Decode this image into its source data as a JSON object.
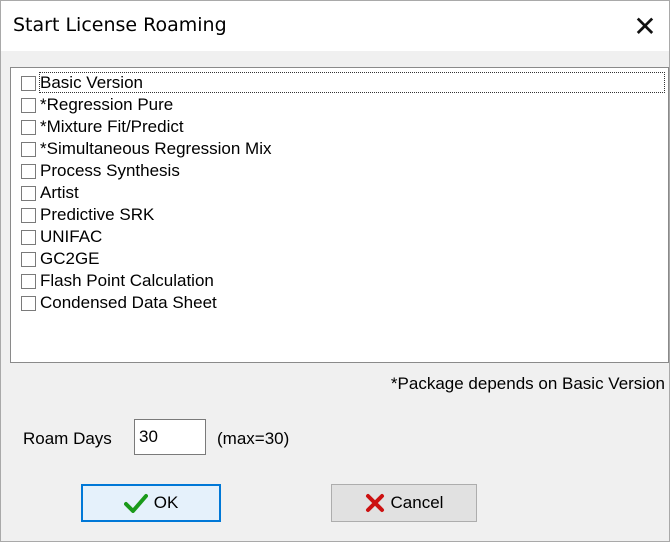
{
  "window": {
    "title": "Start License Roaming",
    "close_glyph": "✕"
  },
  "packages": [
    {
      "label": "Basic Version",
      "checked": false,
      "focused": true
    },
    {
      "label": "*Regression Pure",
      "checked": false
    },
    {
      "label": "*Mixture Fit/Predict",
      "checked": false
    },
    {
      "label": "*Simultaneous Regression Mix",
      "checked": false
    },
    {
      "label": "Process Synthesis",
      "checked": false
    },
    {
      "label": "Artist",
      "checked": false
    },
    {
      "label": "Predictive SRK",
      "checked": false
    },
    {
      "label": "UNIFAC",
      "checked": false
    },
    {
      "label": "GC2GE",
      "checked": false
    },
    {
      "label": "Flash Point Calculation",
      "checked": false
    },
    {
      "label": "Condensed Data Sheet",
      "checked": false
    }
  ],
  "note": "*Package depends on Basic Version",
  "roam": {
    "label": "Roam Days",
    "value": "30",
    "max_text": "(max=30)"
  },
  "buttons": {
    "ok_label": "OK",
    "cancel_label": "Cancel"
  },
  "icons": {
    "ok": "checkmark-icon",
    "cancel": "x-mark-icon"
  },
  "colors": {
    "ok_check": "#1a9a1a",
    "cancel_x": "#cc1111",
    "focus_border": "#0078d7"
  }
}
